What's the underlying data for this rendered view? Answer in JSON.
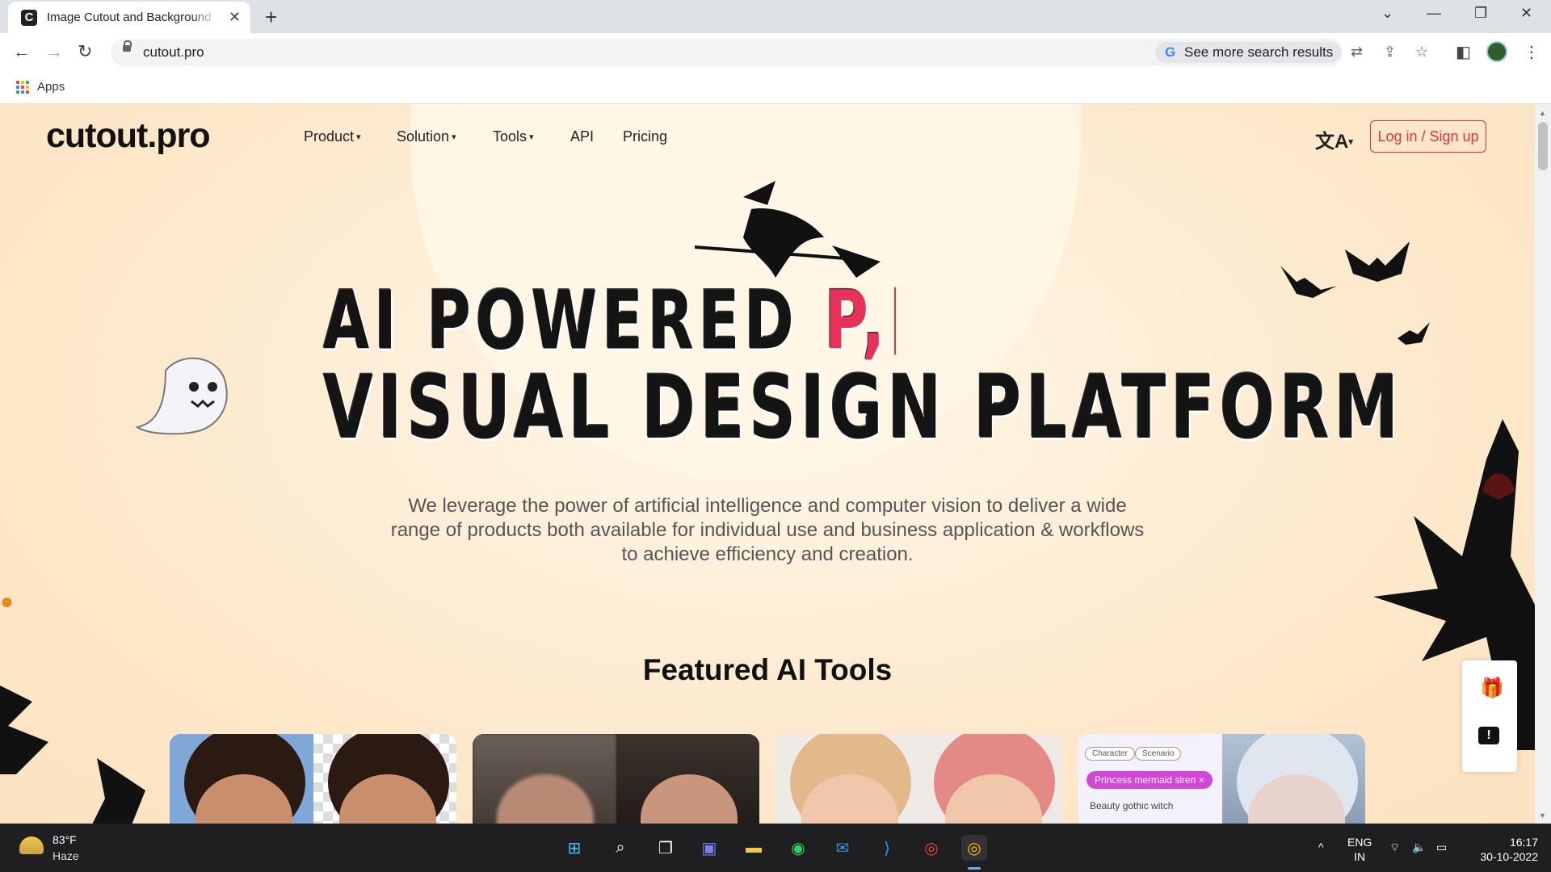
{
  "browser": {
    "tab_title": "Image Cutout and Background Remover",
    "url": "cutout.pro",
    "search_chip": "See more search results",
    "bookmarks_apps": "Apps"
  },
  "site": {
    "logo": "cutout.pro",
    "nav": [
      "Product",
      "Solution",
      "Tools",
      "API",
      "Pricing"
    ],
    "login": "Log in / Sign up",
    "hero_line1": "AI POWERED",
    "hero_line1_accent": "P,",
    "hero_line2": "VISUAL DESIGN PLATFORM",
    "description": "We leverage the power of artificial intelligence and computer vision to deliver a wide range of products both available for individual use and business application & workflows to achieve efficiency and creation.",
    "featured_title": "Featured AI Tools",
    "card4": {
      "tag_character": "Character",
      "tag_scenario": "Scenario",
      "chip": "Princess mermaid siren",
      "chip_close": "×",
      "prompt": "Beauty gothic witch"
    }
  },
  "taskbar": {
    "temperature": "83°F",
    "weather": "Haze",
    "lang_top": "ENG",
    "lang_bottom": "IN",
    "time": "16:17",
    "date": "30-10-2022"
  },
  "icons": {
    "accent_color": "#e8315a",
    "page_bg": "#fde9cc"
  }
}
